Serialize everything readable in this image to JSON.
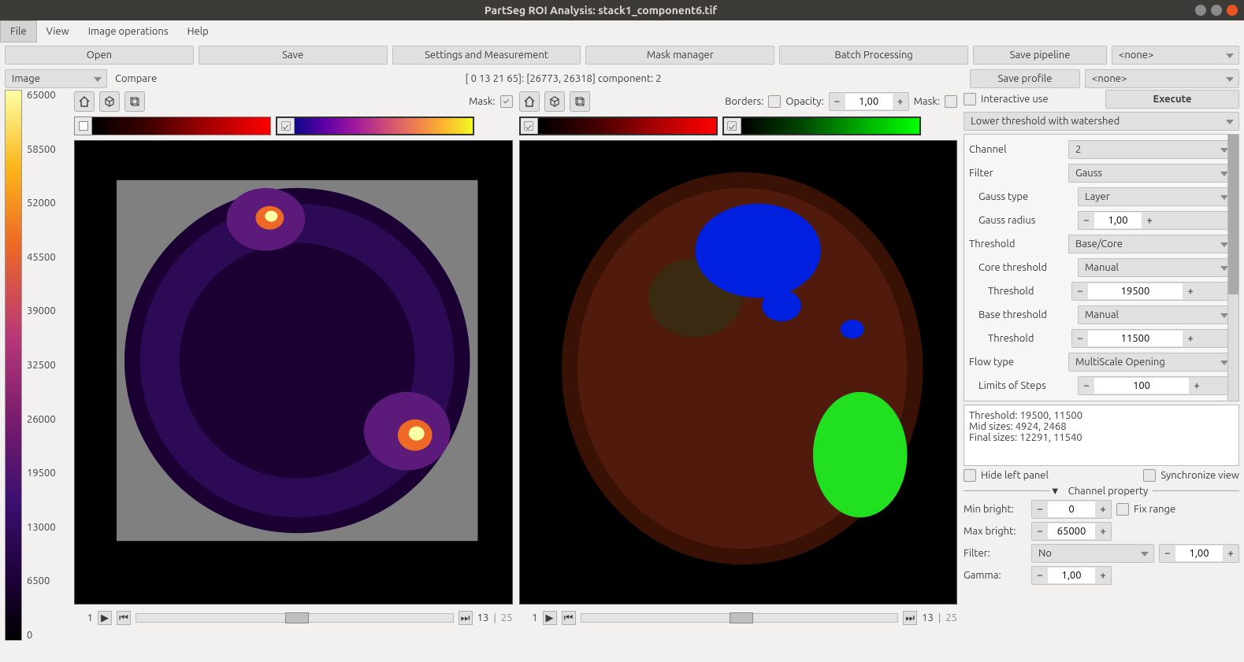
{
  "titlebar": {
    "title": "PartSeg ROI Analysis: stack1_component6.tif"
  },
  "menubar": {
    "file": "File",
    "view": "View",
    "image_ops": "Image operations",
    "help": "Help"
  },
  "toolbar": {
    "open": "Open",
    "save": "Save",
    "settings": "Settings and Measurement",
    "mask_manager": "Mask manager",
    "batch": "Batch Processing",
    "save_pipeline": "Save pipeline",
    "pipeline_sel": "<none>"
  },
  "row2": {
    "image_combo": "Image",
    "compare": "Compare",
    "status": "[ 0 13 21 65]: [26773, 26318] component: 2",
    "save_profile": "Save profile",
    "profile_sel": "<none>"
  },
  "scale_ticks": [
    "65000",
    "58500",
    "52000",
    "45500",
    "39000",
    "32500",
    "26000",
    "19500",
    "13000",
    "6500",
    "0"
  ],
  "viewer_left": {
    "mask_label": "Mask:",
    "foot_page": "1",
    "foot_current": "13",
    "foot_total": "25"
  },
  "viewer_right": {
    "borders_label": "Borders:",
    "opacity_label": "Opacity:",
    "opacity_val": "1,00",
    "mask_label": "Mask:",
    "foot_page": "1",
    "foot_current": "13",
    "foot_total": "25"
  },
  "side": {
    "interactive": "Interactive use",
    "execute": "Execute",
    "algo": "Lower threshold with watershed",
    "params": {
      "channel_l": "Channel",
      "channel_v": "2",
      "filter_l": "Filter",
      "filter_v": "Gauss",
      "gauss_type_l": "Gauss type",
      "gauss_type_v": "Layer",
      "gauss_radius_l": "Gauss radius",
      "gauss_radius_v": "1,00",
      "threshold_l": "Threshold",
      "threshold_v": "Base/Core",
      "core_th_l": "Core threshold",
      "core_th_v": "Manual",
      "core_th_val_l": "Threshold",
      "core_th_val_v": "19500",
      "base_th_l": "Base threshold",
      "base_th_v": "Manual",
      "base_th_val_l": "Threshold",
      "base_th_val_v": "11500",
      "flow_l": "Flow type",
      "flow_v": "MultiScale Opening",
      "limits_l": "Limits of Steps",
      "limits_v": "100"
    },
    "info1": "Threshold: 19500, 11500",
    "info2": "Mid sizes: 4924, 2468",
    "info3": "Final sizes: 12291, 11540",
    "hide_left": "Hide left panel",
    "sync": "Synchronize view",
    "chan_prop": "Channel property",
    "min_b_l": "Min bright:",
    "min_b_v": "0",
    "fix_range": "Fix range",
    "max_b_l": "Max bright:",
    "max_b_v": "65000",
    "cfilter_l": "Filter:",
    "cfilter_v": "No",
    "cfilter_n": "1,00",
    "gamma_l": "Gamma:",
    "gamma_v": "1,00"
  }
}
